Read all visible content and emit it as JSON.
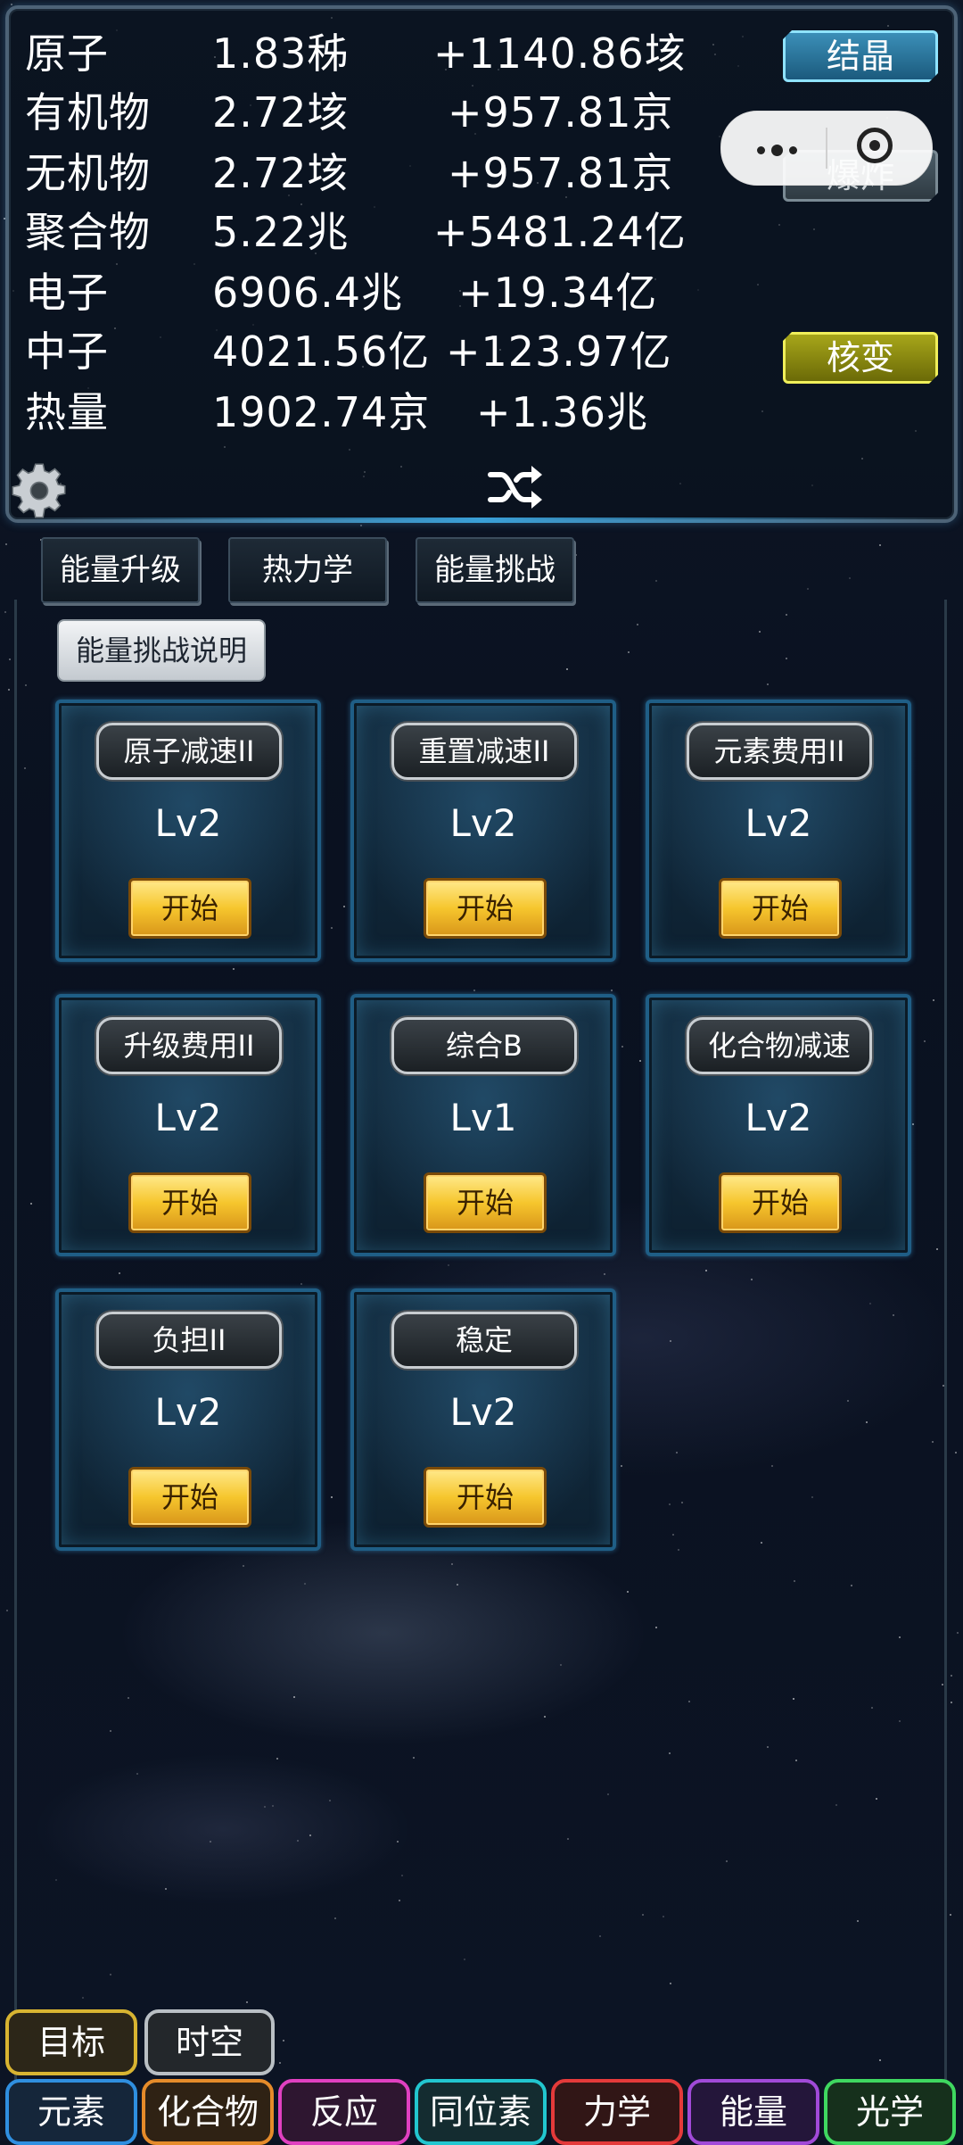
{
  "resources": [
    {
      "name": "原子",
      "value": "1.83秭",
      "rate": "+1140.86垓"
    },
    {
      "name": "有机物",
      "value": "2.72垓",
      "rate": "+957.81京"
    },
    {
      "name": "无机物",
      "value": "2.72垓",
      "rate": "+957.81京"
    },
    {
      "name": "聚合物",
      "value": "5.22兆",
      "rate": "+5481.24亿"
    },
    {
      "name": "电子",
      "value": "6906.4兆",
      "rate": "+19.34亿"
    },
    {
      "name": "中子",
      "value": "4021.56亿",
      "rate": "+123.97亿"
    },
    {
      "name": "热量",
      "value": "1902.74京",
      "rate": "+1.36兆"
    }
  ],
  "side_buttons": {
    "crystal": "结晶",
    "explode": "爆炸",
    "fission": "核变"
  },
  "tabs": [
    "能量升级",
    "热力学",
    "能量挑战"
  ],
  "info_button": "能量挑战说明",
  "cards": [
    {
      "label": "原子减速II",
      "level": "Lv2",
      "button": "开始"
    },
    {
      "label": "重置减速II",
      "level": "Lv2",
      "button": "开始"
    },
    {
      "label": "元素费用II",
      "level": "Lv2",
      "button": "开始"
    },
    {
      "label": "升级费用II",
      "level": "Lv2",
      "button": "开始"
    },
    {
      "label": "综合B",
      "level": "Lv1",
      "button": "开始"
    },
    {
      "label": "化合物减速",
      "level": "Lv2",
      "button": "开始"
    },
    {
      "label": "负担II",
      "level": "Lv2",
      "button": "开始"
    },
    {
      "label": "稳定",
      "level": "Lv2",
      "button": "开始"
    }
  ],
  "bottom_nav": {
    "goal": "目标",
    "spacetime": "时空",
    "items": [
      "元素",
      "化合物",
      "反应",
      "同位素",
      "力学",
      "能量",
      "光学"
    ]
  },
  "icons": {
    "settings": "gear-icon",
    "shuffle": "shuffle-icon",
    "more": "more-dots-icon",
    "close_target": "target-icon"
  }
}
